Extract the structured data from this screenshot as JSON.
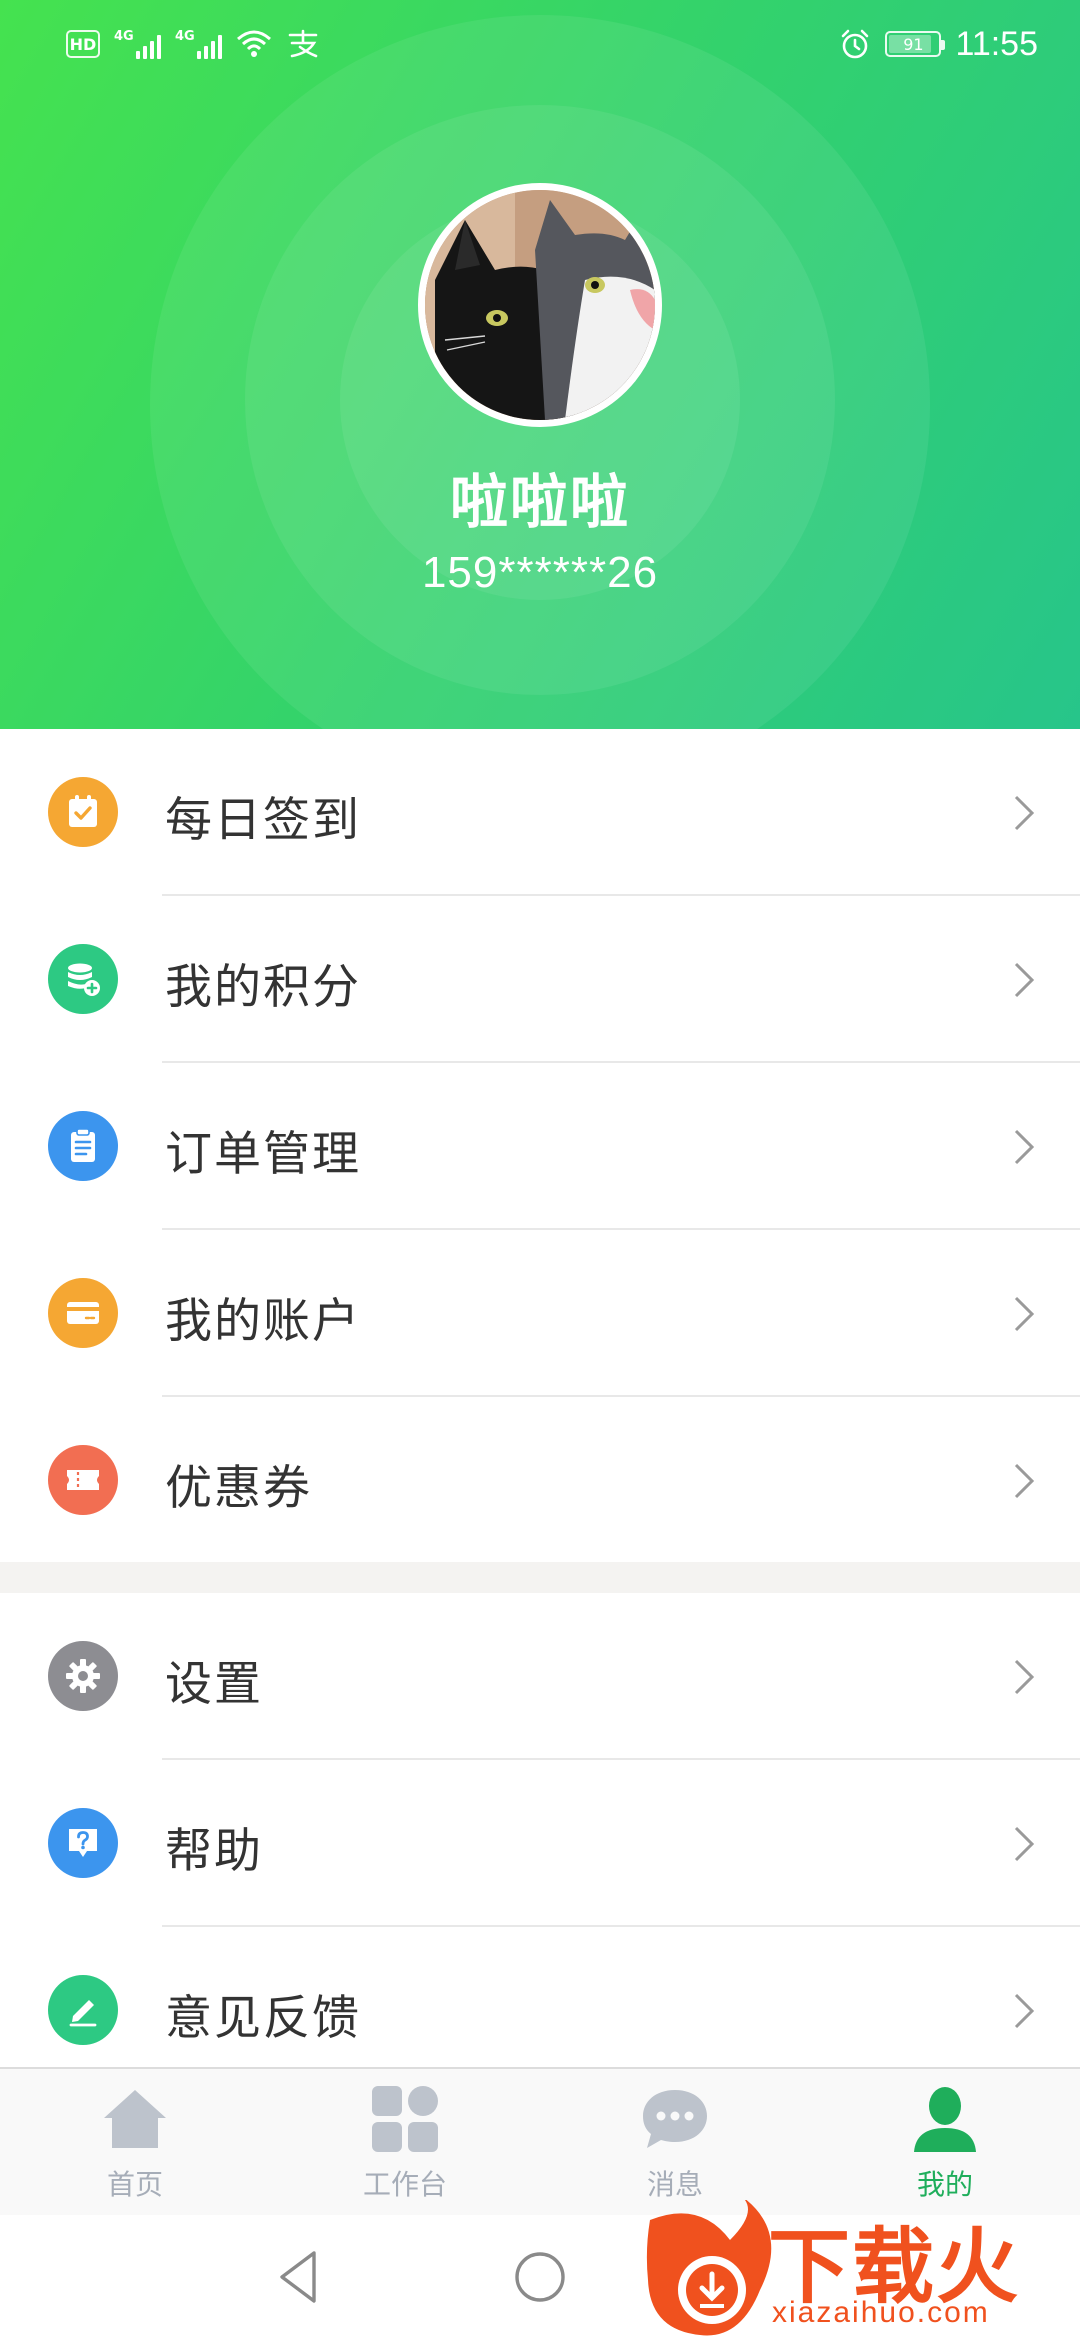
{
  "status_bar": {
    "hd": "HD",
    "network1": "4G",
    "network2": "4G",
    "battery": "91",
    "time": "11:55"
  },
  "profile": {
    "nickname": "啦啦啦",
    "phone": "159******26"
  },
  "menu_primary": [
    {
      "label": "每日签到",
      "icon": "calendar-check-icon",
      "color": "#f5a733"
    },
    {
      "label": "我的积分",
      "icon": "points-database-icon",
      "color": "#2dc983"
    },
    {
      "label": "订单管理",
      "icon": "clipboard-list-icon",
      "color": "#3c95ee"
    },
    {
      "label": "我的账户",
      "icon": "card-icon",
      "color": "#f5a733"
    },
    {
      "label": "优惠券",
      "icon": "ticket-icon",
      "color": "#f26e52"
    }
  ],
  "menu_secondary": [
    {
      "label": "设置",
      "icon": "gear-icon",
      "color": "#8d8d92"
    },
    {
      "label": "帮助",
      "icon": "help-bubble-icon",
      "color": "#3c95ee"
    },
    {
      "label": "意见反馈",
      "icon": "pencil-icon",
      "color": "#2dc983"
    }
  ],
  "tabbar": [
    {
      "label": "首页",
      "icon": "home-icon",
      "active": false
    },
    {
      "label": "工作台",
      "icon": "grid-icon",
      "active": false
    },
    {
      "label": "消息",
      "icon": "chat-bubble-icon",
      "active": false
    },
    {
      "label": "我的",
      "icon": "person-icon",
      "active": true
    }
  ],
  "watermark": {
    "brand": "下载火",
    "domain": "xiazaihuo.com"
  },
  "colors": {
    "header_start": "#45e24f",
    "header_end": "#27c58a",
    "active_tab": "#1fae5b",
    "inactive_tab": "#a6adb8"
  }
}
